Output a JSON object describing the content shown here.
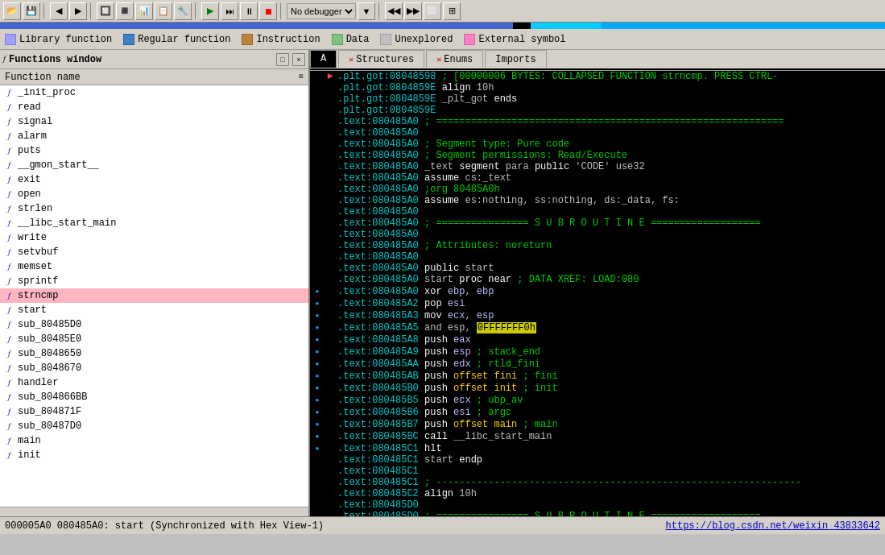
{
  "toolbar": {
    "buttons": [
      "⟵",
      "⟶",
      "▶",
      "⏸",
      "⏹",
      "📋",
      "📁",
      "💾",
      "🔍",
      "🔧",
      "⚙",
      "▶▶",
      "⬛",
      "⬛"
    ]
  },
  "legend": {
    "items": [
      {
        "label": "Library function",
        "color": "#a0a0ff"
      },
      {
        "label": "Regular function",
        "color": "#4080c0"
      },
      {
        "label": "Instruction",
        "color": "#c08040"
      },
      {
        "label": "Data",
        "color": "#80c080"
      },
      {
        "label": "Unexplored",
        "color": "#c0c0c0"
      },
      {
        "label": "External symbol",
        "color": "#ff80c0"
      }
    ]
  },
  "left_panel": {
    "title": "Functions window",
    "col_header": "Function name",
    "functions": [
      {
        "name": "_init_proc",
        "selected": false
      },
      {
        "name": "read",
        "selected": false
      },
      {
        "name": "signal",
        "selected": false
      },
      {
        "name": "alarm",
        "selected": false
      },
      {
        "name": "puts",
        "selected": false
      },
      {
        "name": "__gmon_start__",
        "selected": false
      },
      {
        "name": "exit",
        "selected": false
      },
      {
        "name": "open",
        "selected": false
      },
      {
        "name": "strlen",
        "selected": false
      },
      {
        "name": "__libc_start_main",
        "selected": false
      },
      {
        "name": "write",
        "selected": false
      },
      {
        "name": "setvbuf",
        "selected": false
      },
      {
        "name": "memset",
        "selected": false
      },
      {
        "name": "sprintf",
        "selected": false
      },
      {
        "name": "strncmp",
        "selected": true
      },
      {
        "name": "start",
        "selected": false
      },
      {
        "name": "sub_80485D0",
        "selected": false
      },
      {
        "name": "sub_80485E0",
        "selected": false
      },
      {
        "name": "sub_8048650",
        "selected": false
      },
      {
        "name": "sub_8048670",
        "selected": false
      },
      {
        "name": "handler",
        "selected": false
      },
      {
        "name": "sub_804866BB",
        "selected": false
      },
      {
        "name": "sub_804871F",
        "selected": false
      },
      {
        "name": "sub_80487D0",
        "selected": false
      },
      {
        "name": "main",
        "selected": false
      },
      {
        "name": "init",
        "selected": false
      }
    ]
  },
  "tabs": [
    {
      "label": "A",
      "active": false,
      "type": "addr"
    },
    {
      "label": "Structures",
      "active": false
    },
    {
      "label": "Enums",
      "active": false
    },
    {
      "label": "Imports",
      "active": false
    }
  ],
  "code_lines": [
    {
      "dot": false,
      "arrow": true,
      "content": ".plt.got:08048598 ; [00000006 BYTES: COLLAPSED FUNCTION strncmp. PRESS CTRL-"
    },
    {
      "dot": false,
      "arrow": false,
      "content": ".plt.got:0804859E                         align 10h"
    },
    {
      "dot": false,
      "arrow": false,
      "content": ".plt.got:0804859E  _plt_got          ends"
    },
    {
      "dot": false,
      "arrow": false,
      "content": ".plt.got:0804859E"
    },
    {
      "dot": false,
      "arrow": false,
      "content": ".text:080485A0 ; ============================================================"
    },
    {
      "dot": false,
      "arrow": false,
      "content": ".text:080485A0"
    },
    {
      "dot": false,
      "arrow": false,
      "content": ".text:080485A0 ; Segment type: Pure code"
    },
    {
      "dot": false,
      "arrow": false,
      "content": ".text:080485A0 ; Segment permissions: Read/Execute"
    },
    {
      "dot": false,
      "arrow": false,
      "content": ".text:080485A0  _text             segment para public 'CODE' use32"
    },
    {
      "dot": false,
      "arrow": false,
      "content": ".text:080485A0                           assume cs:_text"
    },
    {
      "dot": false,
      "arrow": false,
      "content": ".text:080485A0                           ;org 80485A0h"
    },
    {
      "dot": false,
      "arrow": false,
      "content": ".text:080485A0                           assume es:nothing, ss:nothing, ds:_data, fs:"
    },
    {
      "dot": false,
      "arrow": false,
      "content": ".text:080485A0"
    },
    {
      "dot": false,
      "arrow": false,
      "content": ".text:080485A0 ; ================ S U B R O U T I N E ==================="
    },
    {
      "dot": false,
      "arrow": false,
      "content": ".text:080485A0"
    },
    {
      "dot": false,
      "arrow": false,
      "content": ".text:080485A0 ; Attributes: noreturn"
    },
    {
      "dot": false,
      "arrow": false,
      "content": ".text:080485A0"
    },
    {
      "dot": false,
      "arrow": false,
      "content": ".text:080485A0                           public start"
    },
    {
      "dot": false,
      "arrow": false,
      "content": ".text:080485A0  start             proc near                 ; DATA XREF: LOAD:080"
    },
    {
      "dot": true,
      "arrow": false,
      "content": ".text:080485A0                           xor     ebp, ebp"
    },
    {
      "dot": true,
      "arrow": false,
      "content": ".text:080485A2                           pop     esi"
    },
    {
      "dot": true,
      "arrow": false,
      "content": ".text:080485A3                           mov     ecx, esp"
    },
    {
      "dot": true,
      "arrow": false,
      "content": ".text:080485A5                           and     esp, 0FFFFFFF0h",
      "highlight": "0FFFFFFF0h"
    },
    {
      "dot": true,
      "arrow": false,
      "content": ".text:080485A8                           push    eax"
    },
    {
      "dot": true,
      "arrow": false,
      "content": ".text:080485A9                           push    esp               ; stack_end"
    },
    {
      "dot": true,
      "arrow": false,
      "content": ".text:080485AA                           push    edx               ; rtld_fini"
    },
    {
      "dot": true,
      "arrow": false,
      "content": ".text:080485AB                           push    offset fini       ; fini"
    },
    {
      "dot": true,
      "arrow": false,
      "content": ".text:080485B0                           push    offset init       ; init"
    },
    {
      "dot": true,
      "arrow": false,
      "content": ".text:080485B5                           push    ecx               ; ubp_av"
    },
    {
      "dot": true,
      "arrow": false,
      "content": ".text:080485B6                           push    esi               ; argc"
    },
    {
      "dot": true,
      "arrow": false,
      "content": ".text:080485B7                           push    offset main       ; main"
    },
    {
      "dot": true,
      "arrow": false,
      "content": ".text:080485BC                           call    __libc_start_main"
    },
    {
      "dot": true,
      "arrow": false,
      "content": ".text:080485C1                           hlt"
    },
    {
      "dot": false,
      "arrow": false,
      "content": ".text:080485C1  start             endp"
    },
    {
      "dot": false,
      "arrow": false,
      "content": ".text:080485C1"
    },
    {
      "dot": false,
      "arrow": false,
      "content": ".text:080485C1 ; ---------------------------------------------------------------"
    },
    {
      "dot": false,
      "arrow": false,
      "content": ".text:080485C2                           align 10h"
    },
    {
      "dot": false,
      "arrow": false,
      "content": ".text:080485D0"
    },
    {
      "dot": false,
      "arrow": false,
      "content": ".text:080485D0 ; ================ S U B R O U T I N E ==================="
    }
  ],
  "status_bar": {
    "text": "000005A0  080485A0: start  (Synchronized with Hex View-1)",
    "url": "https://blog.csdn.net/weixin_43833642"
  }
}
